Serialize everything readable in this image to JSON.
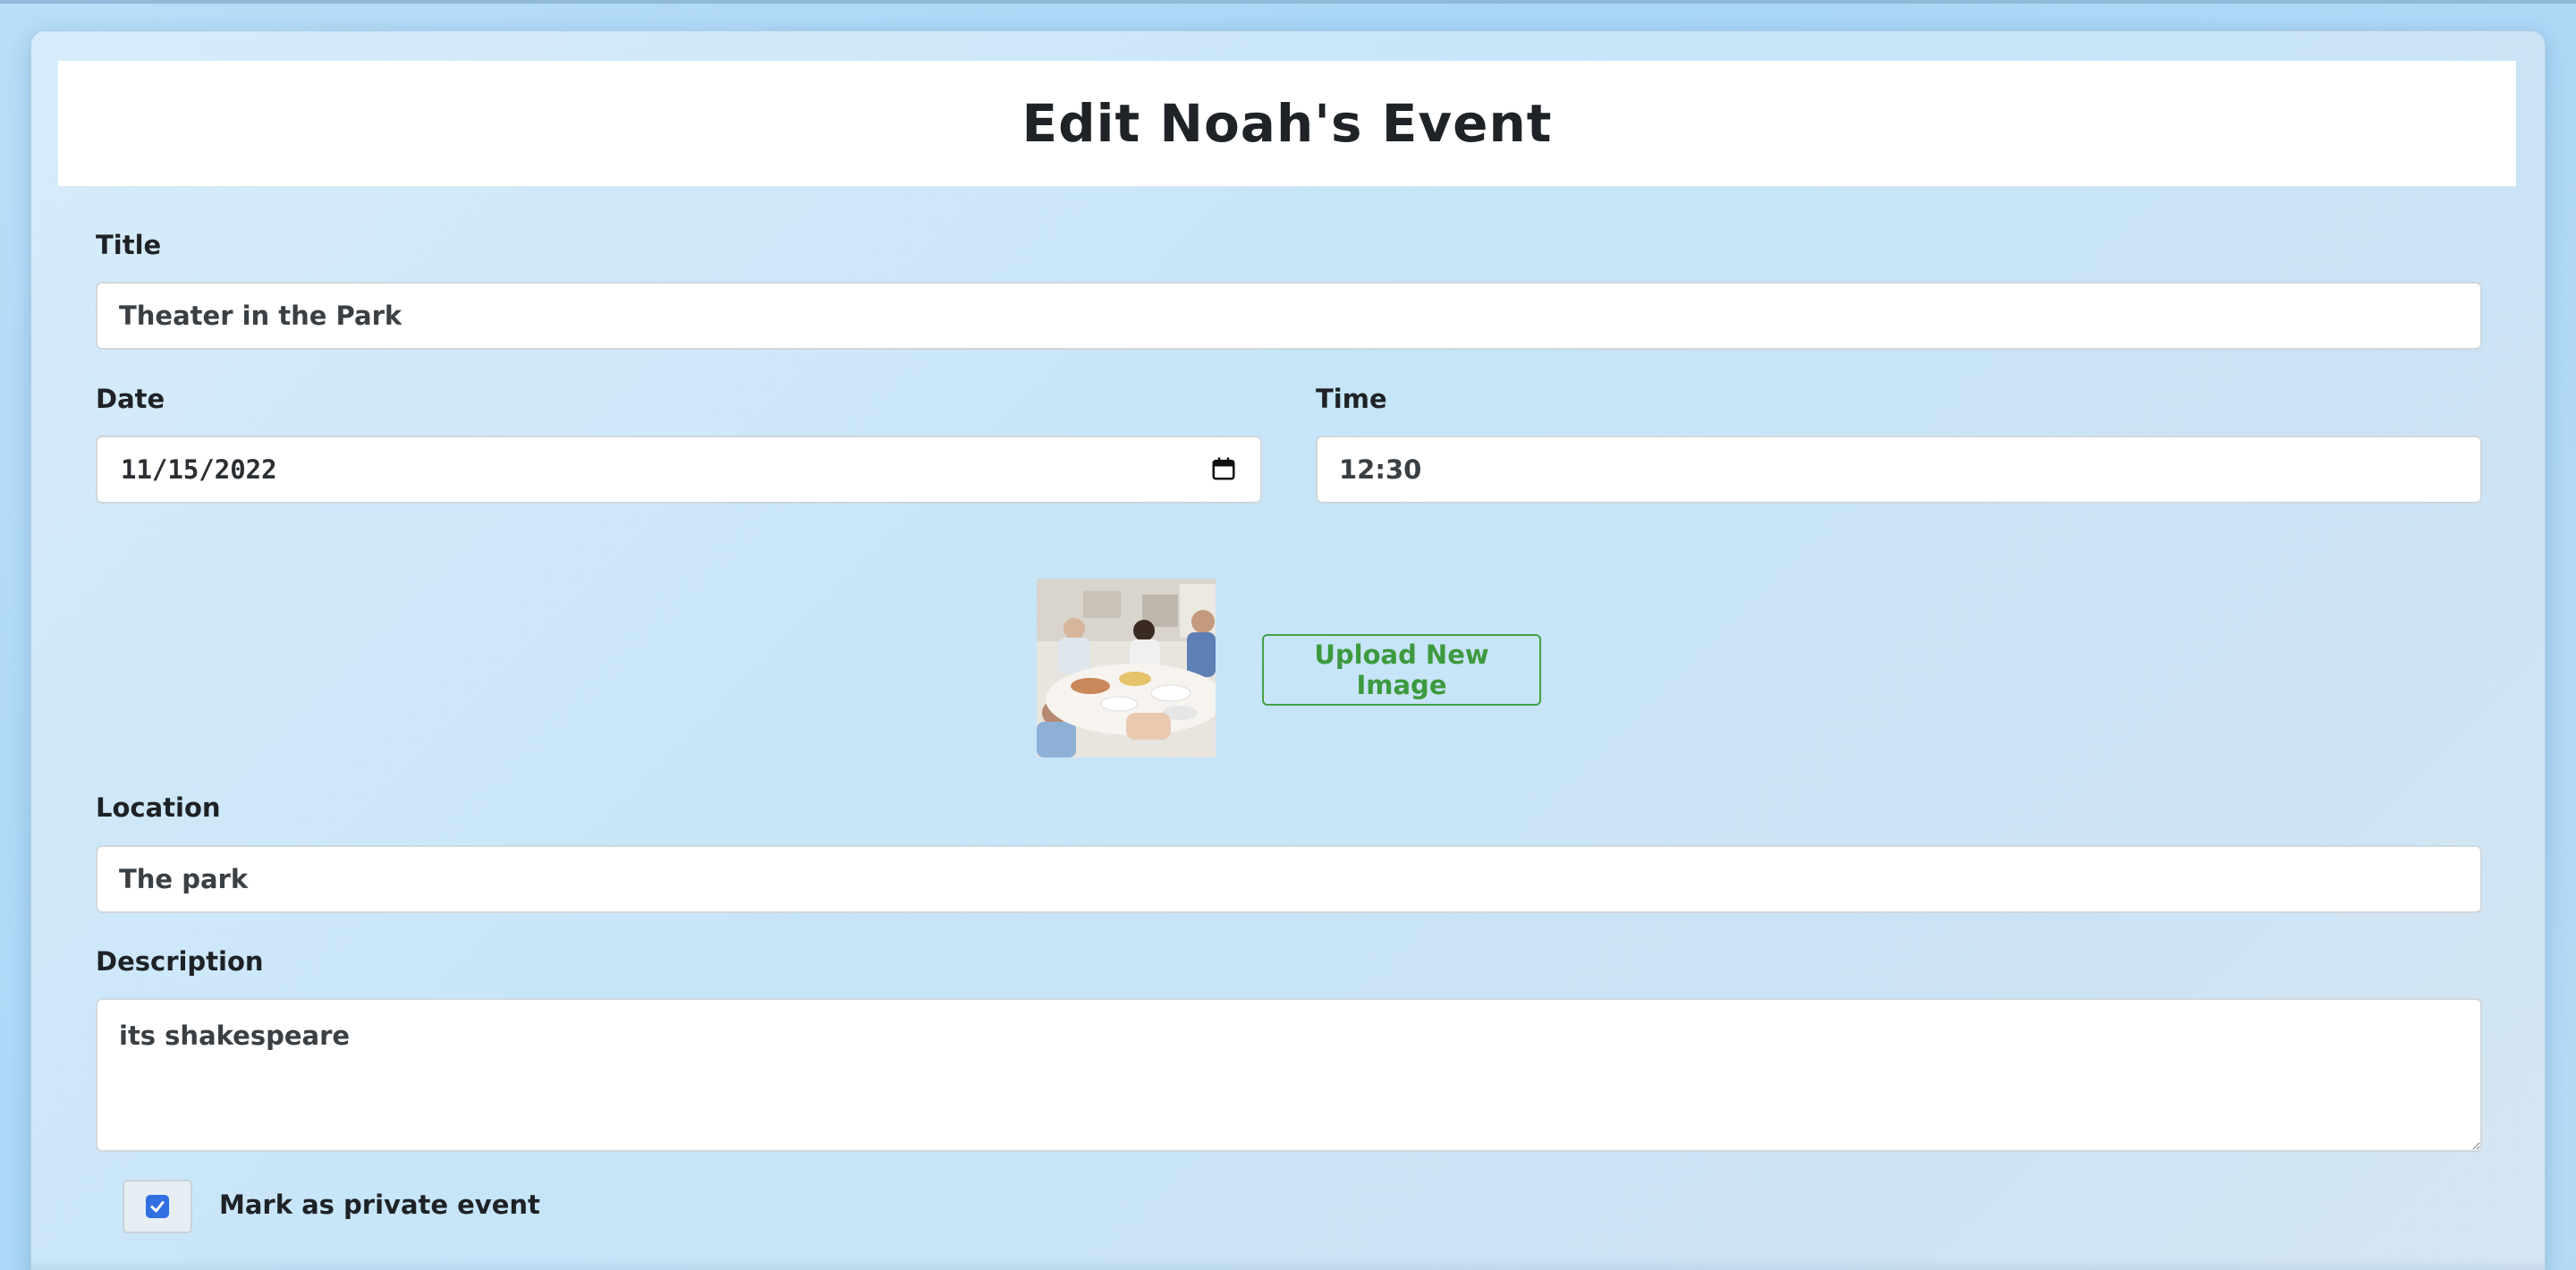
{
  "page": {
    "title": "Edit Noah's Event"
  },
  "form": {
    "title_label": "Title",
    "title_value": "Theater in the Park",
    "date_label": "Date",
    "date_value": "11/15/2022",
    "time_label": "Time",
    "time_value": "12:30",
    "upload_button": "Upload New Image",
    "location_label": "Location",
    "location_value": "The park",
    "description_label": "Description",
    "description_value": "its shakespeare",
    "private_label": "Mark as private event",
    "private_checked": true
  },
  "icons": {
    "date": "calendar-icon",
    "image": "event-image-thumbnail"
  },
  "colors": {
    "accent_green": "#43a047",
    "checkbox_blue": "#2f6fe0",
    "header_bg": "#ffffff"
  }
}
